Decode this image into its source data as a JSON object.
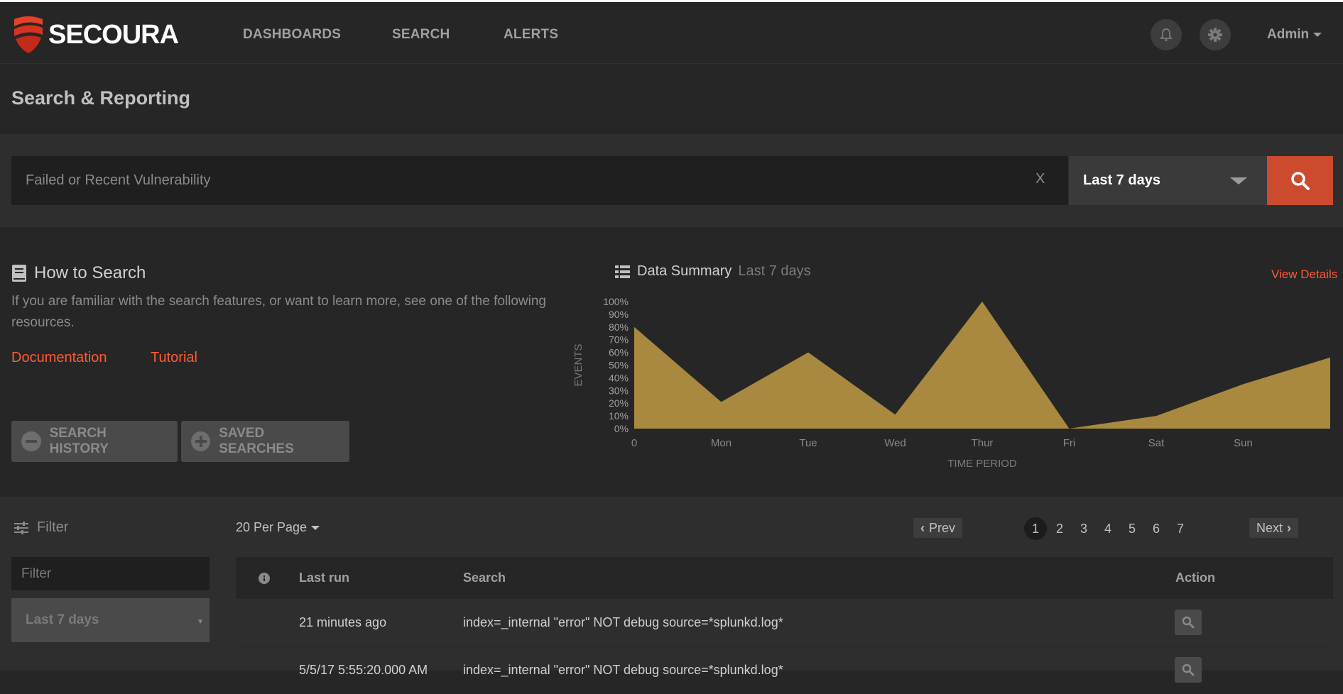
{
  "app": {
    "brand": "SECOURA",
    "accent_color": "#cc4a2e",
    "link_color": "#ff5a36"
  },
  "nav": {
    "items": [
      "DASHBOARDS",
      "SEARCH",
      "ALERTS"
    ],
    "notifications_icon": "bell-icon",
    "settings_icon": "gear-icon",
    "user_label": "Admin"
  },
  "page": {
    "title": "Search & Reporting"
  },
  "search": {
    "placeholder": "Failed or Recent Vulnerability",
    "value": "",
    "clear_label": "X",
    "time_range": "Last 7 days",
    "submit_icon": "search-icon"
  },
  "how_to": {
    "title": "How to Search",
    "body": "If you are familiar with the search features, or want to learn more, see one of the following resources.",
    "links": [
      "Documentation",
      "Tutorial"
    ],
    "history_button": "SEARCH HISTORY",
    "saved_button": "SAVED SEARCHES"
  },
  "summary": {
    "title": "Data Summary",
    "subtitle": "Last 7 days",
    "view_details": "View Details"
  },
  "chart_data": {
    "type": "area",
    "title": "",
    "xlabel": "TIME PERIOD",
    "ylabel": "EVENTS",
    "x_positions": [
      0,
      1,
      2,
      3,
      4,
      5,
      6,
      7,
      8
    ],
    "x_tick_labels": [
      "0",
      "Mon",
      "Tue",
      "Wed",
      "Thur",
      "Fri",
      "Sat",
      "Sun"
    ],
    "x_tick_positions": [
      0,
      1,
      2,
      3,
      4,
      5,
      6,
      7
    ],
    "y_values": [
      80,
      21,
      60,
      11,
      100,
      0,
      10,
      35,
      56
    ],
    "y_tick_labels": [
      "100%",
      "90%",
      "80%",
      "70%",
      "60%",
      "50%",
      "40%",
      "30%",
      "20%",
      "10%",
      "0%"
    ],
    "ylim": [
      0,
      100
    ],
    "xlim": [
      0,
      8
    ],
    "fill_color": "#a8893f",
    "grid": false,
    "legend": "none"
  },
  "filter": {
    "heading": "Filter",
    "input_placeholder": "Filter",
    "range": "Last 7 days"
  },
  "pagination": {
    "per_page": "20 Per Page",
    "prev": "Prev",
    "next": "Next",
    "pages": [
      "1",
      "2",
      "3",
      "4",
      "5",
      "6",
      "7"
    ],
    "active_page": "1"
  },
  "table": {
    "columns": [
      "Last run",
      "Search",
      "Action"
    ],
    "info_icon": "info-icon",
    "rows": [
      {
        "last_run": "21 minutes ago",
        "search": "index=_internal \"error\" NOT debug source=*splunkd.log*"
      },
      {
        "last_run": "5/5/17 5:55:20.000 AM",
        "search": "index=_internal \"error\" NOT debug source=*splunkd.log*"
      }
    ]
  }
}
